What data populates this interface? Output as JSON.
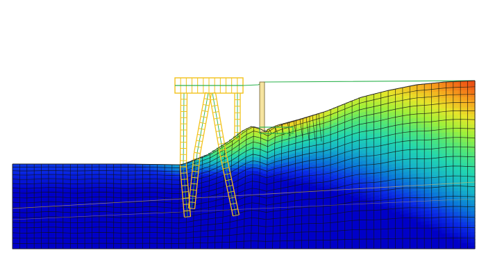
{
  "figure": {
    "description_free": true,
    "colormap": [
      "#0000c8",
      "#0a2ee6",
      "#0a7ad8",
      "#16b4c8",
      "#22d6b0",
      "#4ee67a",
      "#9ef03a",
      "#e6e62a",
      "#f6a81e",
      "#f05a14",
      "#c81e0a"
    ],
    "mesh_line_color": "#101010",
    "structure_color": "#f2c21a",
    "structure_detail_color": "#2bb24c",
    "outline_color": "#5a5a5a"
  },
  "structure": {
    "piles": [
      {
        "id": "pile-left-vertical"
      },
      {
        "id": "pile-left-raked"
      },
      {
        "id": "pile-right-raked"
      },
      {
        "id": "pile-right-vertical"
      }
    ]
  }
}
